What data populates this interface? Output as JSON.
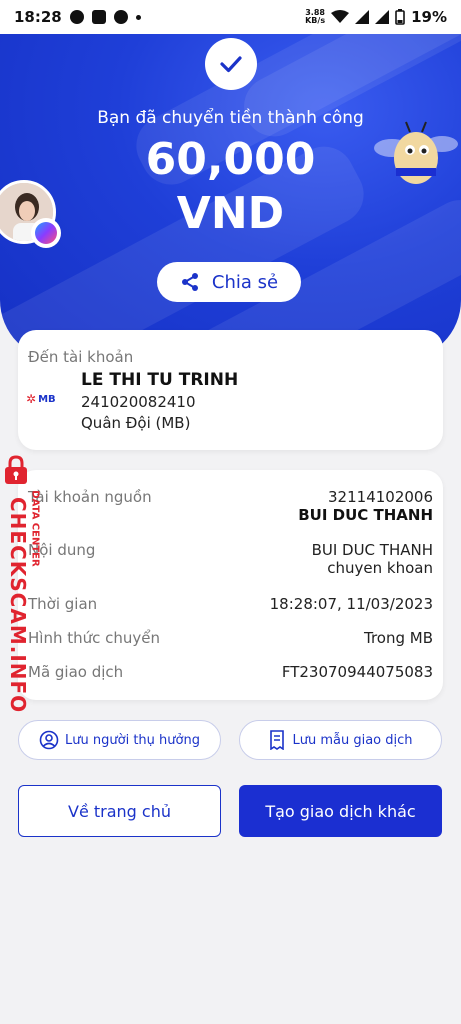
{
  "status_bar": {
    "time": "18:28",
    "speed": "3.88",
    "speed_unit": "KB/s",
    "battery": "19%"
  },
  "receipt": {
    "success_message": "Bạn đã chuyển tiền thành công",
    "amount": "60,000",
    "currency": "VND",
    "share_label": "Chia sẻ"
  },
  "recipient": {
    "label": "Đến tài khoản",
    "bank_logo_text": "MB",
    "name": "LE THI TU TRINH",
    "account_number": "241020082410",
    "bank": "Quân Đội (MB)"
  },
  "details": {
    "source_label": "Tài khoản nguồn",
    "source_account": "32114102006",
    "source_name": "BUI DUC THANH",
    "content_label": "Nội dung",
    "content_line1": "BUI DUC THANH",
    "content_line2": "chuyen khoan",
    "time_label": "Thời gian",
    "time_value": "18:28:07, 11/03/2023",
    "method_label": "Hình thức chuyển",
    "method_value": "Trong MB",
    "txn_label": "Mã giao dịch",
    "txn_value": "FT23070944075083"
  },
  "actions": {
    "save_beneficiary": "Lưu người thụ hưởng",
    "save_template": "Lưu mẫu giao dịch",
    "home": "Về trang chủ",
    "new_transaction": "Tạo giao dịch khác"
  },
  "watermark": {
    "site": "CHECKSCAM.INFO",
    "sub": "DATA CENTER"
  },
  "colors": {
    "brand_blue": "#1b33c9",
    "watermark_red": "#e0242f"
  }
}
